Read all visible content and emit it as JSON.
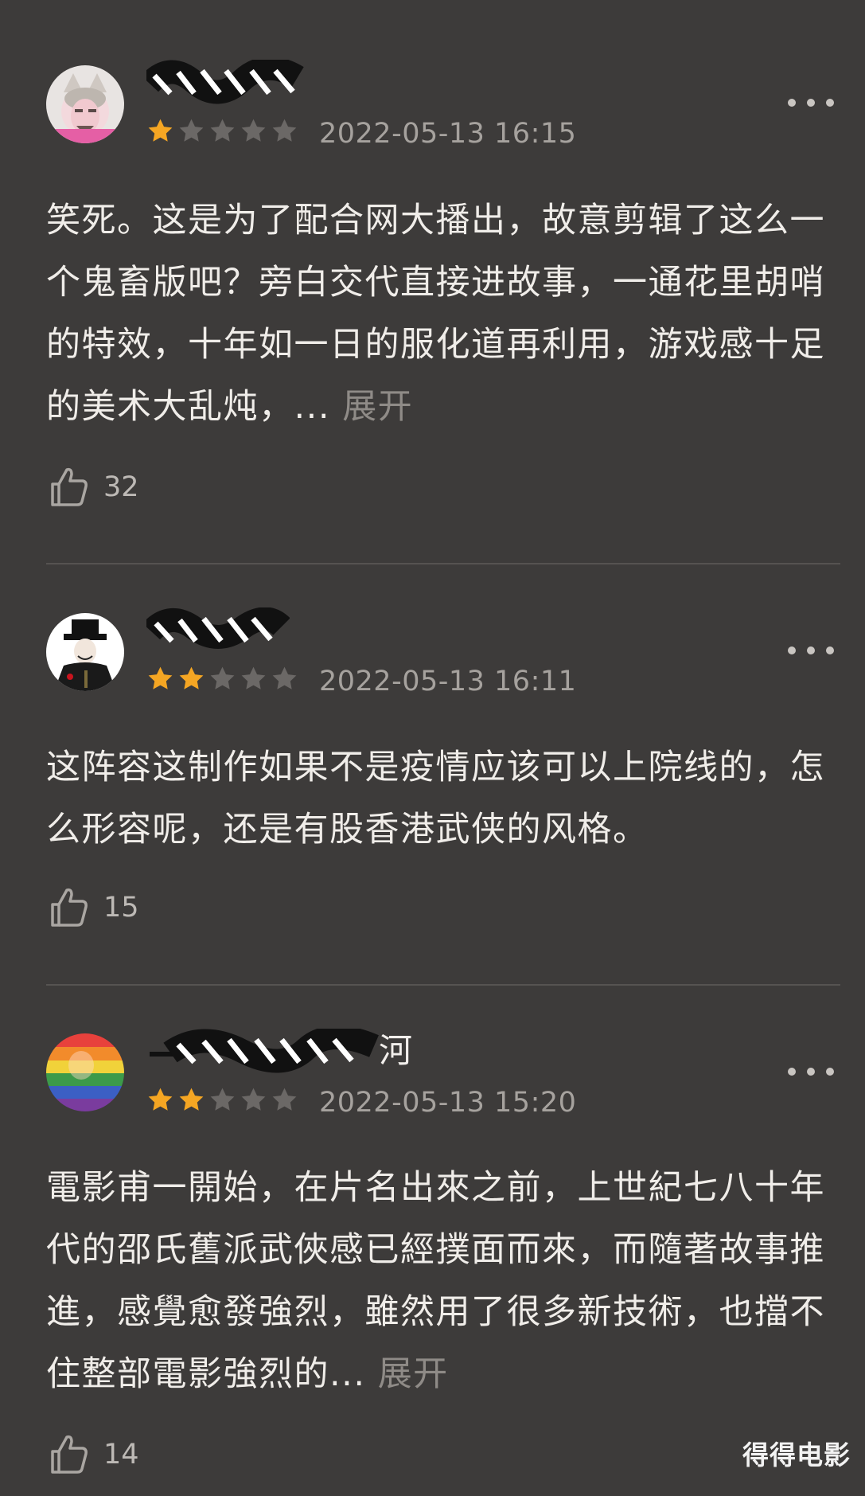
{
  "reviews": [
    {
      "username": "",
      "rating": 1,
      "max_rating": 5,
      "timestamp": "2022-05-13 16:15",
      "content": "笑死。这是为了配合网大播出，故意剪辑了这么一个鬼畜版吧？旁白交代直接进故事，一通花里胡哨的特效，十年如一日的服化道再利用，游戏感十足的美术大乱炖，...",
      "expand_label": "展开",
      "likes": "32",
      "avatar": "avatar-man-with-wolf-headdress"
    },
    {
      "username": "",
      "rating": 2,
      "max_rating": 5,
      "timestamp": "2022-05-13 16:11",
      "content": "这阵容这制作如果不是疫情应该可以上院线的，怎么形容呢，还是有股香港武侠的风格。",
      "expand_label": "",
      "likes": "15",
      "avatar": "avatar-figure-in-black-hat"
    },
    {
      "username": "河",
      "rating": 2,
      "max_rating": 5,
      "timestamp": "2022-05-13 15:20",
      "content": "電影甫一開始，在片名出來之前，上世紀七八十年代的邵氏舊派武俠感已經撲面而來，而隨著故事推進，感覺愈發強烈，雖然用了很多新技術，也擋不住整部電影強烈的...",
      "expand_label": "展开",
      "likes": "14",
      "avatar": "avatar-rainbow-flag"
    }
  ],
  "watermark": "得得电影",
  "colors": {
    "background": "#3d3b3a",
    "star_filled": "#f5a623",
    "star_empty": "#6b6866",
    "timestamp": "#a6a29e",
    "expand": "#8f8b87"
  },
  "icons": {
    "like": "thumbs-up-icon",
    "more": "more-dots-icon",
    "star": "star-icon"
  }
}
